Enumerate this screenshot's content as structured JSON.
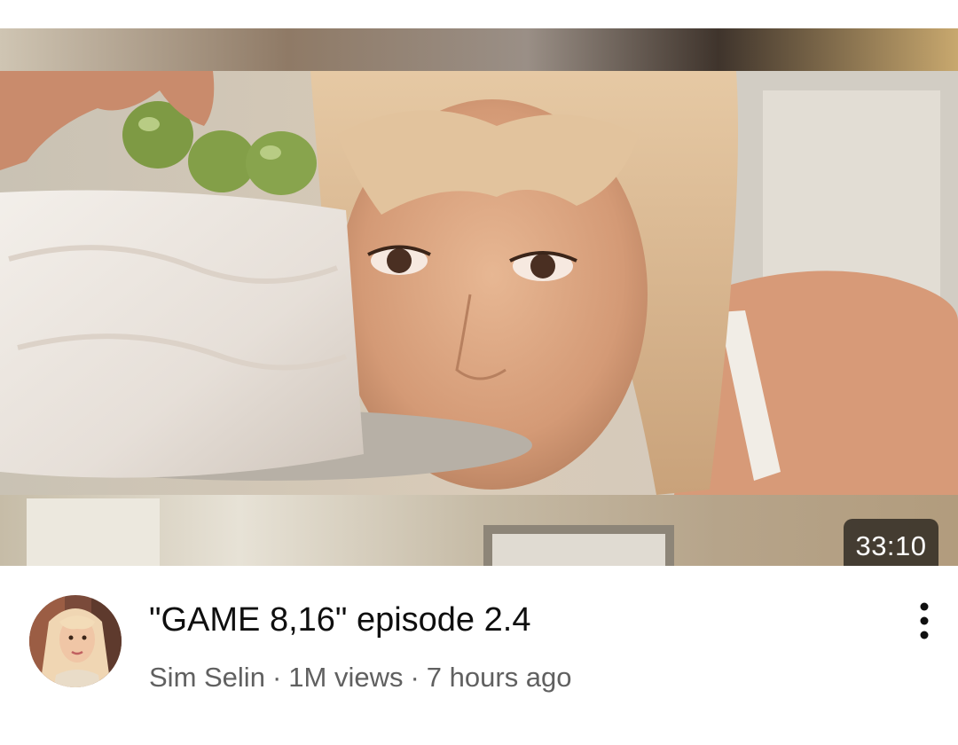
{
  "video": {
    "duration": "33:10",
    "title": "\"GAME 8,16\" episode 2.4",
    "channel": "Sim Selin",
    "views": "1M views",
    "age": "7 hours ago",
    "separator": "·"
  },
  "icons": {
    "more": "more-vert-icon",
    "avatar": "channel-avatar"
  },
  "colors": {
    "title": "#0f0f0f",
    "secondary": "#606060",
    "duration_bg": "#000000",
    "background": "#ffffff"
  }
}
